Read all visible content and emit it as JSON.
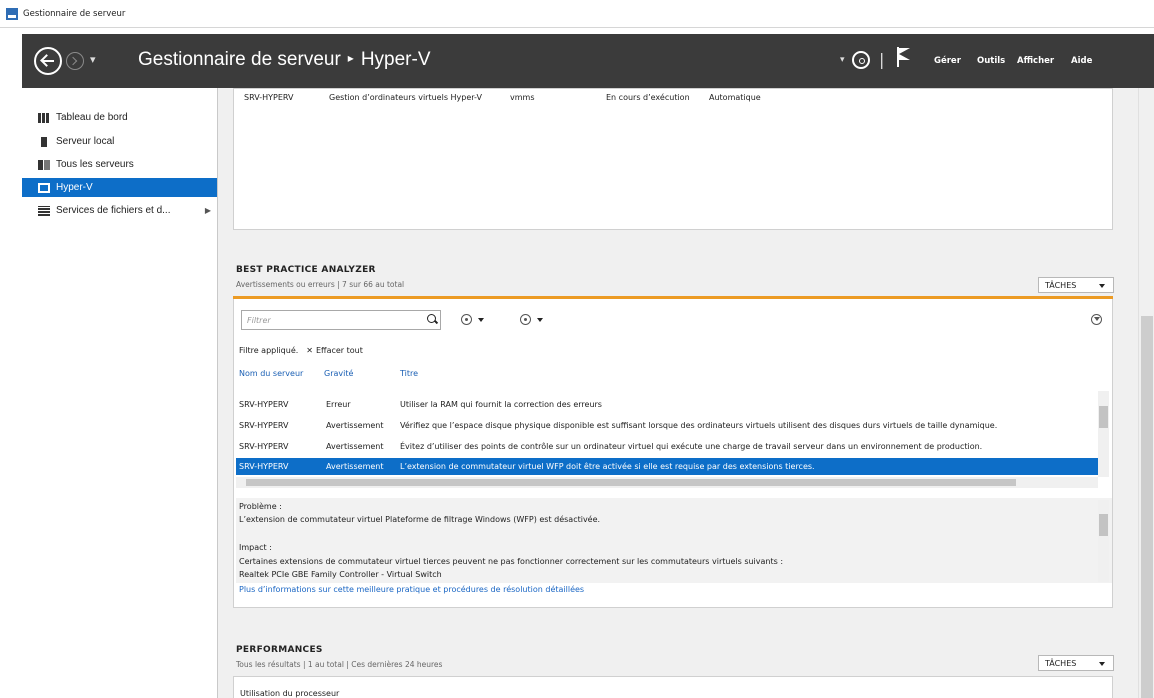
{
  "window": {
    "title": "Gestionnaire de serveur"
  },
  "header": {
    "app": "Gestionnaire de serveur",
    "location": "Hyper-V",
    "menu": [
      "Gérer",
      "Outils",
      "Afficher",
      "Aide"
    ]
  },
  "sidebar": {
    "items": [
      {
        "label": "Tableau de bord",
        "icon": "dashboard-icon"
      },
      {
        "label": "Serveur local",
        "icon": "server-icon"
      },
      {
        "label": "Tous les serveurs",
        "icon": "servers-icon"
      },
      {
        "label": "Hyper-V",
        "icon": "hyperv-icon",
        "active": true
      },
      {
        "label": "Services de fichiers et d...",
        "icon": "file-services-icon",
        "expandable": true
      }
    ]
  },
  "services": {
    "row": {
      "server": "SRV-HYPERV",
      "display_name": "Gestion d’ordinateurs virtuels Hyper-V",
      "service": "vmms",
      "status": "En cours d’exécution",
      "start_type": "Automatique"
    }
  },
  "bpa": {
    "title": "BEST PRACTICE ANALYZER",
    "subtitle": "Avertissements ou erreurs | 7 sur 66 au total",
    "tasks_label": "TÂCHES",
    "filter_placeholder": "Filtrer",
    "filter_applied": "Filtre appliqué.",
    "clear_all": "Effacer tout",
    "columns": [
      "Nom du serveur",
      "Gravité",
      "Titre"
    ],
    "rows": [
      {
        "server": "SRV-HYPERV",
        "severity": "Erreur",
        "title": "Utiliser la RAM qui fournit la correction des erreurs"
      },
      {
        "server": "SRV-HYPERV",
        "severity": "Avertissement",
        "title": "Vérifiez que l’espace disque physique disponible est suffisant lorsque des ordinateurs virtuels utilisent des disques durs virtuels de taille dynamique."
      },
      {
        "server": "SRV-HYPERV",
        "severity": "Avertissement",
        "title": "Évitez d’utiliser des points de contrôle sur un ordinateur virtuel qui exécute une charge de travail serveur dans un environnement de production."
      },
      {
        "server": "SRV-HYPERV",
        "severity": "Avertissement",
        "title": "L’extension de commutateur virtuel WFP doit être activée si elle est requise par des extensions tierces.",
        "selected": true
      }
    ],
    "details": {
      "problem_label": "Problème :",
      "problem_text": "L’extension de commutateur virtuel Plateforme de filtrage Windows (WFP) est désactivée.",
      "impact_label": "Impact :",
      "impact_text": "Certaines extensions de commutateur virtuel tierces peuvent ne pas fonctionner correctement sur les commutateurs virtuels suivants :",
      "impact_item": "Realtek PCIe GBE Family Controller - Virtual Switch",
      "more_link": "Plus d’informations sur cette meilleure pratique et procédures de résolution détaillées"
    }
  },
  "performance": {
    "title": "PERFORMANCES",
    "subtitle": "Tous les résultats | 1 au total | Ces dernières 24 heures",
    "tasks_label": "TÂCHES",
    "first_row": "Utilisation du processeur"
  },
  "colors": {
    "header_bg": "#3b3b3b",
    "selection": "#0d6ec8",
    "accent_orange": "#ec9b24",
    "link": "#1a66c4"
  }
}
